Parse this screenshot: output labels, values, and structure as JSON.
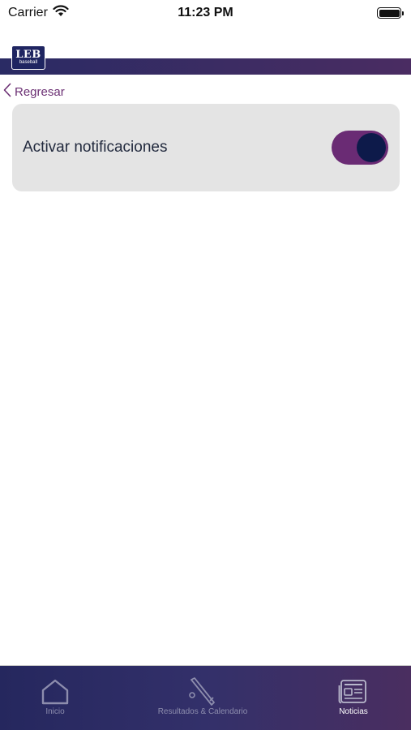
{
  "status_bar": {
    "carrier": "Carrier",
    "time": "11:23 PM"
  },
  "header": {
    "logo_main": "LEB",
    "logo_sub": "baseball"
  },
  "nav": {
    "back_label": "Regresar"
  },
  "settings": {
    "notifications_label": "Activar notificaciones",
    "notifications_enabled": true
  },
  "tab_bar": {
    "tabs": [
      {
        "label": "Inicio",
        "icon": "home-icon",
        "active": false
      },
      {
        "label": "Resultados & Calendario",
        "icon": "baseball-bat-icon",
        "active": false
      },
      {
        "label": "Noticias",
        "icon": "newspaper-icon",
        "active": true
      }
    ]
  },
  "colors": {
    "accent": "#6a2b74",
    "knob": "#0d1a4a",
    "header_start": "#2a2b64",
    "header_end": "#4a2c62",
    "card_bg": "#e4e4e4"
  }
}
